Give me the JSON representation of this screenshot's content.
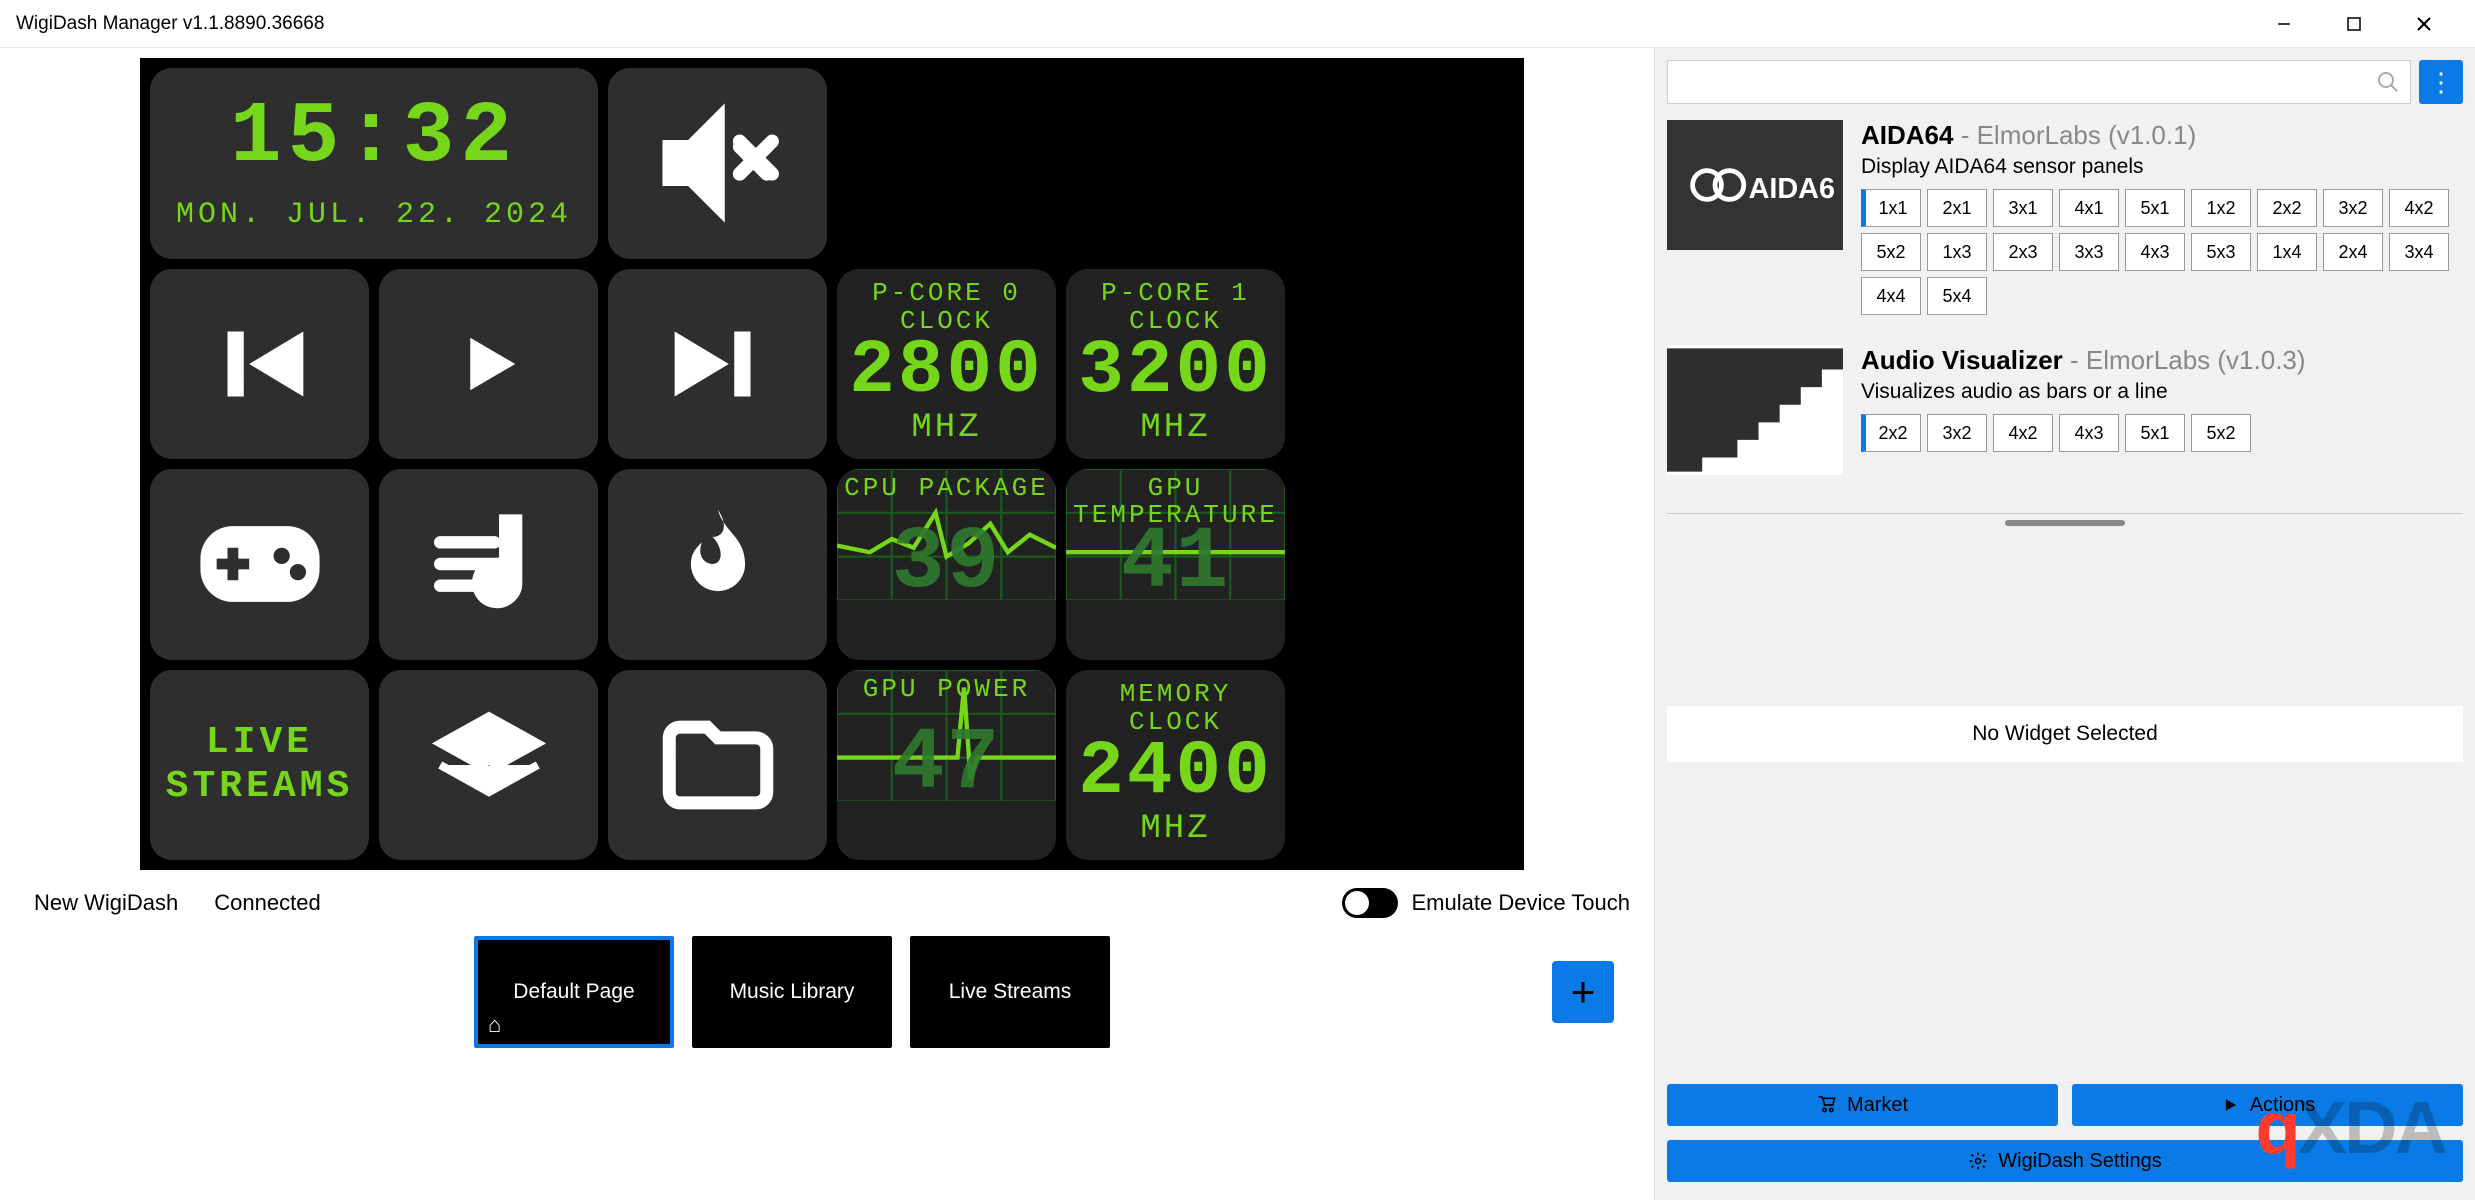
{
  "window": {
    "title": "WigiDash Manager v1.1.8890.36668"
  },
  "dash": {
    "clock": {
      "time": "15:32",
      "date": "MON. JUL. 22. 2024"
    },
    "live_streams_label": "LIVE\nSTREAMS",
    "pcore0": {
      "title": "P-CORE 0\nCLOCK",
      "value": "2800",
      "unit": "MHZ"
    },
    "pcore1": {
      "title": "P-CORE 1\nCLOCK",
      "value": "3200",
      "unit": "MHZ"
    },
    "cpu_pkg": {
      "title": "CPU PACKAGE",
      "value": "39"
    },
    "gpu_temp": {
      "title": "GPU\nTEMPERATURE",
      "value": "41"
    },
    "gpu_power": {
      "title": "GPU POWER",
      "value": "47"
    },
    "mem_clock": {
      "title": "MEMORY CLOCK",
      "value": "2400",
      "unit": "MHZ"
    }
  },
  "status": {
    "device": "New WigiDash",
    "connection": "Connected",
    "emulate_label": "Emulate Device Touch"
  },
  "pages": {
    "items": [
      {
        "label": "Default Page",
        "active": true,
        "home": true
      },
      {
        "label": "Music Library",
        "active": false,
        "home": false
      },
      {
        "label": "Live Streams",
        "active": false,
        "home": false
      }
    ]
  },
  "sidebar": {
    "widgets": [
      {
        "name": "AIDA64",
        "vendor": " - ElmorLabs (v1.0.1)",
        "desc": "Display AIDA64 sensor panels",
        "sizes": [
          "1x1",
          "2x1",
          "3x1",
          "4x1",
          "5x1",
          "1x2",
          "2x2",
          "3x2",
          "4x2",
          "5x2",
          "1x3",
          "2x3",
          "3x3",
          "4x3",
          "5x3",
          "1x4",
          "2x4",
          "3x4",
          "4x4",
          "5x4"
        ],
        "active_size": "1x1"
      },
      {
        "name": "Audio Visualizer",
        "vendor": " - ElmorLabs (v1.0.3)",
        "desc": "Visualizes audio as bars or a line",
        "sizes": [
          "2x2",
          "3x2",
          "4x2",
          "4x3",
          "5x1",
          "5x2"
        ],
        "active_size": "2x2"
      }
    ],
    "no_widget": "No Widget Selected",
    "buttons": {
      "market": "Market",
      "actions": "Actions",
      "settings": "WigiDash Settings"
    }
  }
}
